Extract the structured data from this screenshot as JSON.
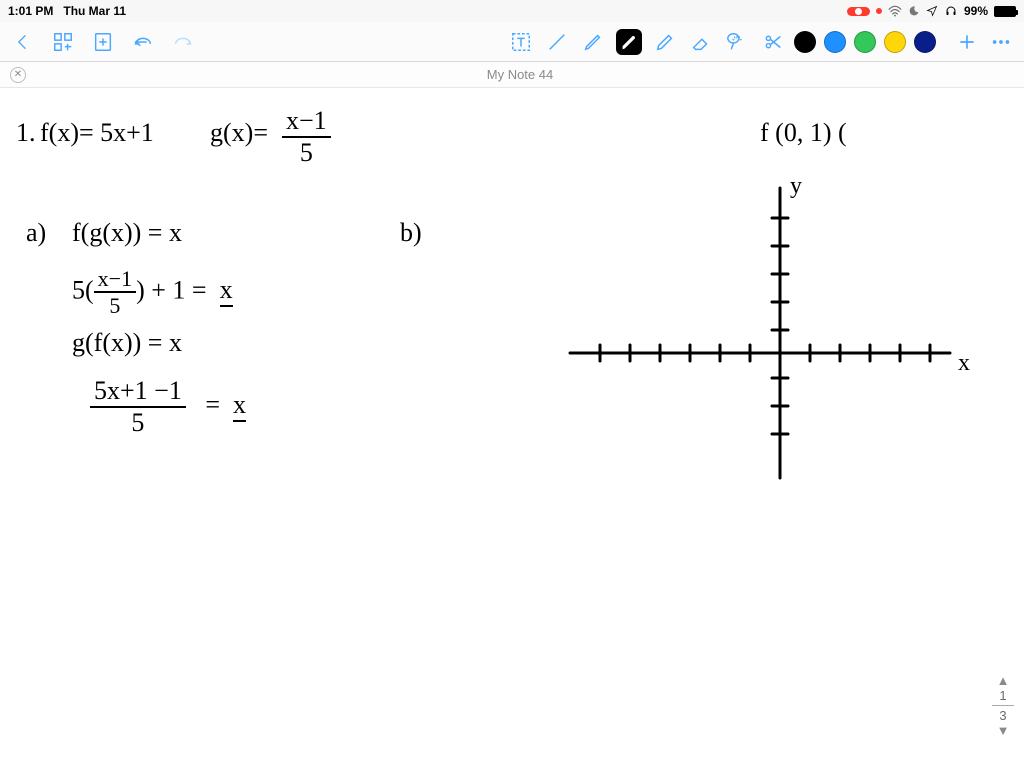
{
  "status": {
    "time": "1:01 PM",
    "date": "Thu Mar 11",
    "battery_pct": "99%"
  },
  "toolbar": {
    "colors": [
      "#000000",
      "#1e90ff",
      "#34c759",
      "#ffd60a",
      "#0a1e8a"
    ]
  },
  "doc": {
    "title": "My Note 44"
  },
  "notes": {
    "problem_label": "1.",
    "f_def": "f(x)= 5x+1",
    "g_def_lhs": "g(x)=",
    "g_num": "x−1",
    "g_den": "5",
    "part_a_label": "a)",
    "a_line1": "f(g(x)) = x",
    "a_line2_lhs_coef": "5(",
    "a_line2_num": "x−1",
    "a_line2_den": "5",
    "a_line2_rest": ") + 1  =",
    "a_line2_rhs": "x",
    "a_line3": "g(f(x)) = x",
    "a_line4_num": "5x+1 −1",
    "a_line4_den": "5",
    "a_line4_eq": "=",
    "a_line4_rhs": "x",
    "part_b_label": "b)",
    "f_point": "f  (0, 1)   (",
    "axis_y": "y",
    "axis_x": "x"
  },
  "pager": {
    "current": "1",
    "total": "3"
  }
}
